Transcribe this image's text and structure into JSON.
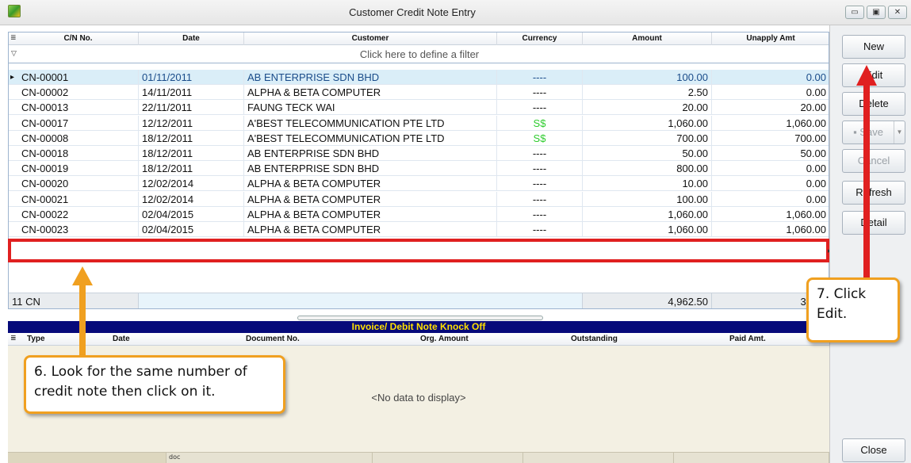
{
  "window": {
    "title": "Customer Credit Note Entry",
    "controls": [
      "▭",
      "▣",
      "✕"
    ]
  },
  "grid": {
    "columns": [
      "C/N No.",
      "Date",
      "Customer",
      "Currency",
      "Amount",
      "Unapply Amt"
    ],
    "filter_text": "Click here to define a filter",
    "rows": [
      {
        "cn": "CN-00001",
        "date": "01/11/2011",
        "customer": "AB ENTERPRISE SDN BHD",
        "currency": "----",
        "amount": "100.00",
        "unapply": "0.00"
      },
      {
        "cn": "CN-00002",
        "date": "14/11/2011",
        "customer": "ALPHA & BETA COMPUTER",
        "currency": "----",
        "amount": "2.50",
        "unapply": "0.00"
      },
      {
        "cn": "CN-00013",
        "date": "22/11/2011",
        "customer": "FAUNG TECK WAI",
        "currency": "----",
        "amount": "20.00",
        "unapply": "20.00"
      },
      {
        "cn": "CN-00017",
        "date": "12/12/2011",
        "customer": "A'BEST TELECOMMUNICATION PTE LTD",
        "currency": "S$",
        "amount": "1,060.00",
        "unapply": "1,060.00"
      },
      {
        "cn": "CN-00008",
        "date": "18/12/2011",
        "customer": "A'BEST TELECOMMUNICATION PTE LTD",
        "currency": "S$",
        "amount": "700.00",
        "unapply": "700.00"
      },
      {
        "cn": "CN-00018",
        "date": "18/12/2011",
        "customer": "AB ENTERPRISE SDN BHD",
        "currency": "----",
        "amount": "50.00",
        "unapply": "50.00"
      },
      {
        "cn": "CN-00019",
        "date": "18/12/2011",
        "customer": "AB ENTERPRISE SDN BHD",
        "currency": "----",
        "amount": "800.00",
        "unapply": "0.00"
      },
      {
        "cn": "CN-00020",
        "date": "12/02/2014",
        "customer": "ALPHA & BETA COMPUTER",
        "currency": "----",
        "amount": "10.00",
        "unapply": "0.00"
      },
      {
        "cn": "CN-00021",
        "date": "12/02/2014",
        "customer": "ALPHA & BETA COMPUTER",
        "currency": "----",
        "amount": "100.00",
        "unapply": "0.00"
      },
      {
        "cn": "CN-00022",
        "date": "02/04/2015",
        "customer": "ALPHA & BETA COMPUTER",
        "currency": "----",
        "amount": "1,060.00",
        "unapply": "1,060.00"
      },
      {
        "cn": "CN-00023",
        "date": "02/04/2015",
        "customer": "ALPHA & BETA COMPUTER",
        "currency": "----",
        "amount": "1,060.00",
        "unapply": "1,060.00"
      }
    ],
    "footer": {
      "count": "11 CN",
      "amount_total": "4,962.50",
      "unapply_total": "3,950"
    }
  },
  "knock_off": {
    "title": "Invoice/ Debit Note Knock Off",
    "columns": [
      "Type",
      "Date",
      "Document No.",
      "Org. Amount",
      "Outstanding",
      "Paid Amt."
    ],
    "empty_text": "<No data to display>",
    "footer_label": "doc"
  },
  "buttons": {
    "new": "New",
    "edit": "Edit",
    "delete": "Delete",
    "save": "Save",
    "cancel": "Cancel",
    "refresh": "Refresh",
    "detail": "Detail",
    "close": "Close"
  },
  "callouts": {
    "step6": "6. Look for the same number of credit note then click on it.",
    "step7": "7. Click Edit."
  },
  "colors": {
    "highlight_box": "#e02020",
    "callout_border": "#f0a020",
    "knock_title_bg": "#060a7a",
    "knock_title_fg": "#ffe000",
    "currency_sgd": "#2ecc2e"
  }
}
